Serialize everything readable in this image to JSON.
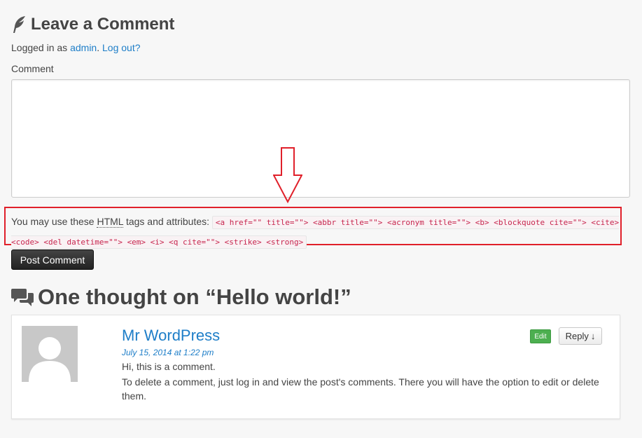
{
  "reply": {
    "title": "Leave a Comment",
    "logged_in_prefix": "Logged in as",
    "username": "admin",
    "logout": "Log out?",
    "comment_label": "Comment",
    "comment_value": "",
    "allowed_prefix": "You may use these",
    "allowed_abbr": "HTML",
    "allowed_suffix": "tags and attributes:",
    "allowed_tags_code": "<a href=\"\" title=\"\"> <abbr title=\"\"> <acronym title=\"\"> <b> <blockquote cite=\"\"> <cite> <code> <del datetime=\"\"> <em> <i> <q cite=\"\"> <strike> <strong>",
    "submit": "Post Comment"
  },
  "comments": {
    "title": "One thought on “Hello world!”",
    "items": [
      {
        "author": "Mr WordPress",
        "date": "July 15, 2014 at 1:22 pm",
        "text1": "Hi, this is a comment.",
        "text2": "To delete a comment, just log in and view the post's comments. There you will have the option to edit or delete them.",
        "edit": "Edit",
        "reply": "Reply",
        "reply_arrow": "↓"
      }
    ]
  },
  "colors": {
    "link": "#1e7ec8",
    "highlight": "#e0202a",
    "edit_button": "#4caf50"
  }
}
